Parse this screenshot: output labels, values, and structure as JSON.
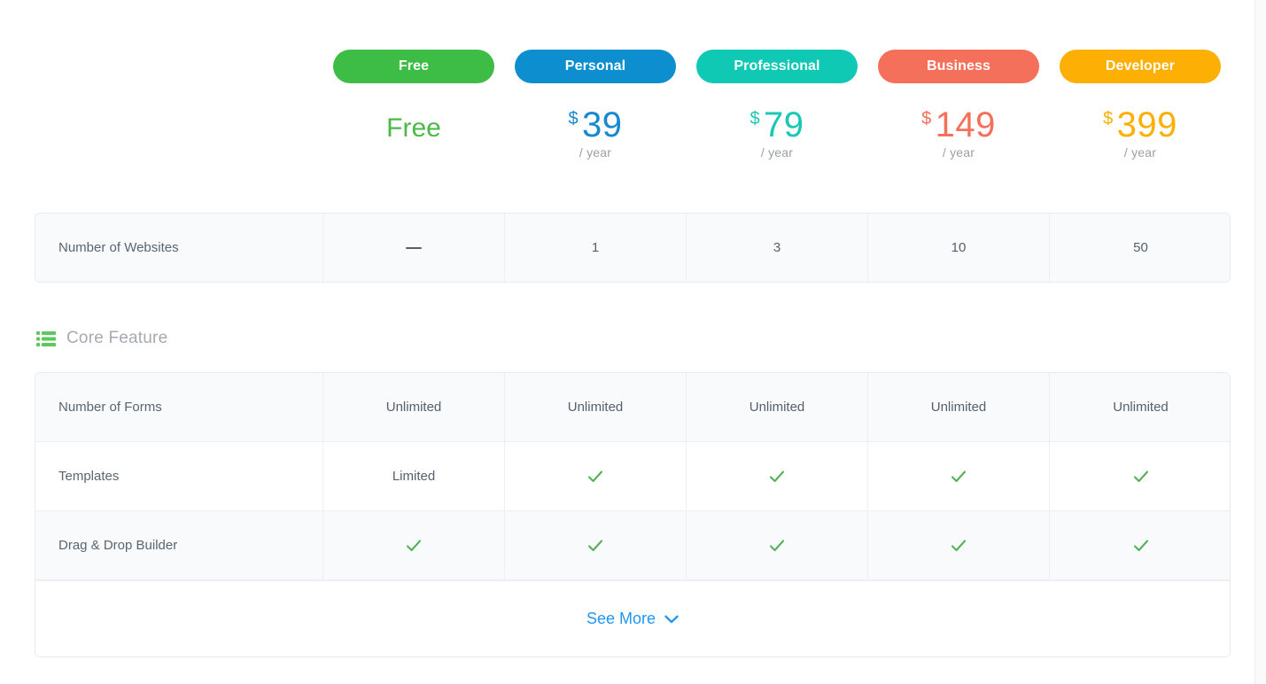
{
  "plans": [
    {
      "name": "Free",
      "pill_color": "#3ebd46",
      "price_color": "#4cb848",
      "currency": "",
      "amount": "Free",
      "period": "",
      "is_free": true
    },
    {
      "name": "Personal",
      "pill_color": "#0d8ecf",
      "price_color": "#1789d0",
      "currency": "$",
      "amount": "39",
      "period": "/ year",
      "is_free": false
    },
    {
      "name": "Professional",
      "pill_color": "#0fc9b5",
      "price_color": "#18c7b4",
      "currency": "$",
      "amount": "79",
      "period": "/ year",
      "is_free": false
    },
    {
      "name": "Business",
      "pill_color": "#f4705a",
      "price_color": "#f4705a",
      "currency": "$",
      "amount": "149",
      "period": "/ year",
      "is_free": false
    },
    {
      "name": "Developer",
      "pill_color": "#fdb003",
      "price_color": "#fdb003",
      "currency": "$",
      "amount": "399",
      "period": "/ year",
      "is_free": false
    }
  ],
  "summary_table": {
    "rows": [
      {
        "feature": "Number of Websites",
        "values": [
          "—",
          "1",
          "3",
          "10",
          "50"
        ],
        "types": [
          "dash",
          "text",
          "text",
          "text",
          "text"
        ]
      }
    ]
  },
  "core_feature_section": {
    "icon": "list-icon",
    "icon_color": "#5cc95c",
    "title": "Core Feature"
  },
  "core_feature_table": {
    "rows": [
      {
        "feature": "Number of Forms",
        "values": [
          "Unlimited",
          "Unlimited",
          "Unlimited",
          "Unlimited",
          "Unlimited"
        ],
        "types": [
          "text",
          "text",
          "text",
          "text",
          "text"
        ]
      },
      {
        "feature": "Templates",
        "values": [
          "Limited",
          "",
          "",
          "",
          ""
        ],
        "types": [
          "text",
          "check",
          "check",
          "check",
          "check"
        ]
      },
      {
        "feature": "Drag & Drop Builder",
        "values": [
          "",
          "",
          "",
          "",
          ""
        ],
        "types": [
          "check",
          "check",
          "check",
          "check",
          "check"
        ]
      }
    ],
    "see_more_label": "See More",
    "see_more_icon": "chevron-down-icon",
    "see_more_color": "#2196f3"
  }
}
